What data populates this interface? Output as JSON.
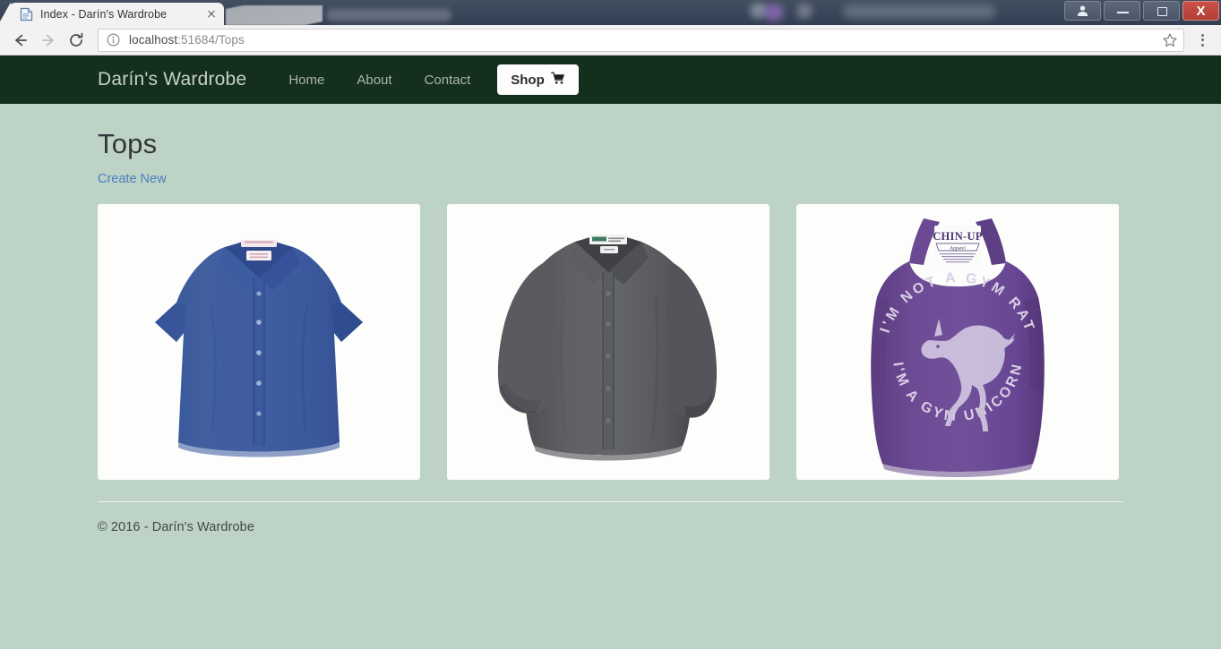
{
  "browser": {
    "tab": {
      "title": "Index - Darín's Wardrobe",
      "favicon_icon": "page-icon",
      "close_icon": "close-icon"
    },
    "back_icon": "back-arrow-icon",
    "forward_icon": "forward-arrow-icon",
    "reload_icon": "reload-icon",
    "omnibox": {
      "info_icon": "info-circle-icon",
      "url_host": "localhost",
      "url_rest": ":51684/Tops",
      "url_full": "localhost:51684/Tops",
      "star_icon": "star-bookmark-icon"
    },
    "menu_icon": "three-dot-menu-icon",
    "window_controls": {
      "profile_icon": "person-profile-icon",
      "minimize_icon": "minimize-icon",
      "maximize_icon": "maximize-restore-icon",
      "close_label": "X",
      "close_icon": "window-close-icon"
    }
  },
  "navbar": {
    "brand": "Darín's Wardrobe",
    "links": [
      {
        "label": "Home"
      },
      {
        "label": "About"
      },
      {
        "label": "Contact"
      }
    ],
    "shop": {
      "label": "Shop",
      "icon": "shopping-cart-icon",
      "glyph": "🛒"
    },
    "bg_color": "#14301c"
  },
  "page": {
    "title": "Tops",
    "create_new_label": "Create New",
    "background_color": "#bdd3c6",
    "link_color": "#4a7fc1"
  },
  "products": [
    {
      "name": "blue-short-sleeve-shirt",
      "alt": "Blue short sleeve button-down shirt",
      "color": "#3a5fa8"
    },
    {
      "name": "gray-long-sleeve-shirt",
      "alt": "Gray long sleeve button-down shirt",
      "color": "#5e6064"
    },
    {
      "name": "purple-gym-unicorn-tank-top",
      "alt": "Purple tank top",
      "color": "#6b4a93",
      "graphic": {
        "brand": "CHIN-UP",
        "text_top": "I'M NOT A GYM RAT",
        "text_bottom": "I'M A GYM UNICORN"
      }
    }
  ],
  "footer": {
    "text": "© 2016 - Darín's Wardrobe"
  }
}
